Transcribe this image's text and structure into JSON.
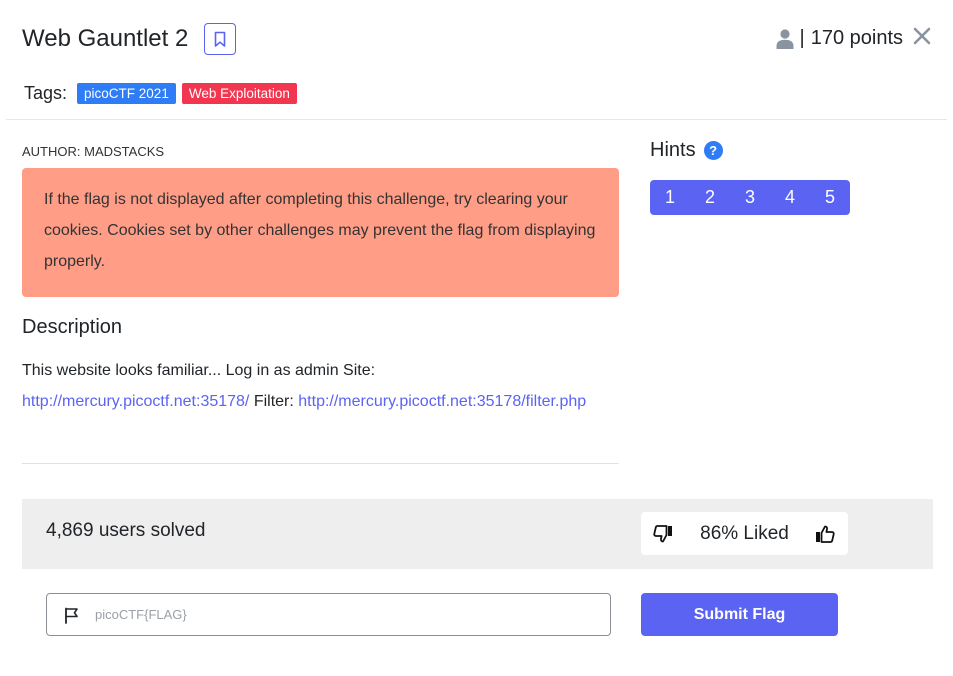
{
  "challenge": {
    "title": "Web Gauntlet 2",
    "points_separator": "|",
    "points": "170 points"
  },
  "tags": {
    "label": "Tags:",
    "items": [
      {
        "label": "picoCTF 2021",
        "color": "#2e7cf6"
      },
      {
        "label": "Web Exploitation",
        "color": "#f2364f"
      }
    ]
  },
  "author": "AUTHOR: MADSTACKS",
  "alert": {
    "text": "If the flag is not displayed after completing this challenge, try clearing your cookies. Cookies set by other challenges may prevent the flag from displaying properly.",
    "color": "#ff9d87"
  },
  "description": {
    "heading": "Description",
    "intro": "This website looks familiar... Log in as admin Site:",
    "site_link": "http://mercury.picoctf.net:35178/",
    "filter_label": "Filter:",
    "filter_link": "http://mercury.picoctf.net:35178/filter.php"
  },
  "hints": {
    "heading": "Hints",
    "help_icon": "?",
    "items": [
      "1",
      "2",
      "3",
      "4",
      "5"
    ]
  },
  "stats": {
    "solved": "4,869 users solved",
    "liked": "86% Liked"
  },
  "flag": {
    "placeholder": "picoCTF{FLAG}",
    "value": "",
    "submit_label": "Submit Flag"
  },
  "icons": {
    "bookmark": "bookmark-icon",
    "user": "user-icon",
    "close": "close-icon",
    "help": "help-icon",
    "thumbs_down": "thumbs-down-icon",
    "thumbs_up": "thumbs-up-icon",
    "flag": "flag-icon"
  },
  "colors": {
    "accent": "#5b63f2",
    "link": "#5b63f2"
  }
}
